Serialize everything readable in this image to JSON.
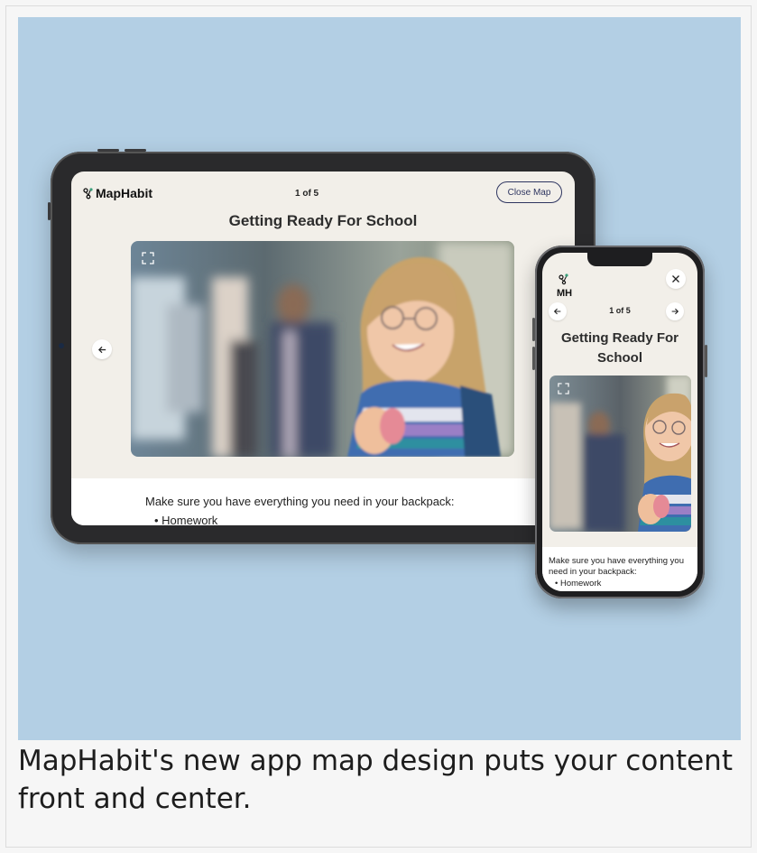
{
  "tablet": {
    "brand": "MapHabit",
    "counter": "1 of 5",
    "close_button": "Close Map",
    "title": "Getting Ready For School",
    "instruction": "Make sure you have everything you need in your backpack:",
    "list_items": [
      "Homework"
    ],
    "icons": {
      "expand": "expand-icon",
      "back": "arrow-left-icon",
      "logo": "maphabit-logo-icon"
    }
  },
  "phone": {
    "logo_text": "MH",
    "counter": "1 of 5",
    "title": "Getting Ready For School",
    "instruction": "Make sure you have everything you need in your backpack:",
    "list_items": [
      "Homework"
    ],
    "icons": {
      "close": "close-icon",
      "prev": "arrow-left-icon",
      "next": "arrow-right-icon",
      "expand": "expand-icon"
    }
  },
  "caption": "MapHabit's new app map design puts your content front and center.",
  "colors": {
    "hero_background": "#b3cfe4",
    "device_frame": "#2a2a2c",
    "screen_background": "#f2efe9",
    "accent_navy": "#2e3560"
  }
}
